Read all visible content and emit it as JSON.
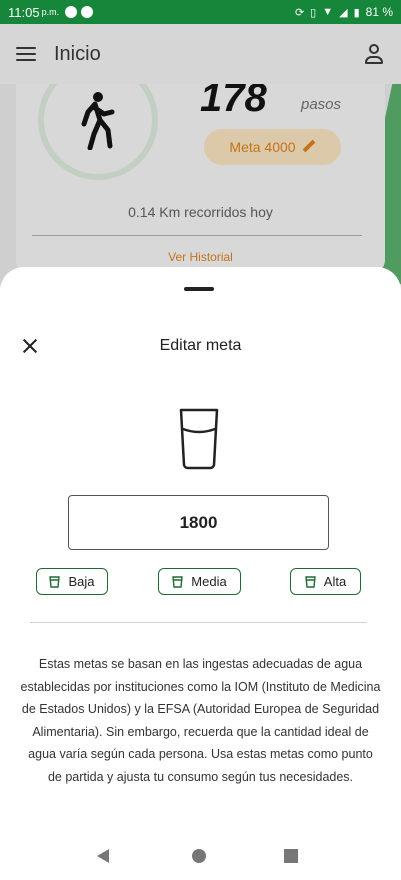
{
  "status_bar": {
    "time": "11:05",
    "ampm": "p.m.",
    "battery": "81 %"
  },
  "app_bar": {
    "title": "Inicio"
  },
  "background_card": {
    "steps": "178",
    "steps_unit": "pasos",
    "goal_label": "Meta 4000",
    "distance_text": "0.14 Km recorridos hoy",
    "history_link": "Ver Historial"
  },
  "sheet": {
    "title": "Editar meta",
    "amount_value": "1800",
    "levels": [
      {
        "label": "Baja"
      },
      {
        "label": "Media"
      },
      {
        "label": "Alta"
      }
    ],
    "info_text": "Estas metas se basan en las ingestas adecuadas de agua establecidas por instituciones como la IOM (Instituto de Medicina de Estados Unidos) y la EFSA (Autoridad Europea de Seguridad Alimentaria). Sin embargo, recuerda que la cantidad ideal de agua varía según cada persona. Usa estas metas como punto de partida y ajusta tu consumo según tus necesidades."
  },
  "colors": {
    "status_bar": "#16863a",
    "accent_orange": "#c4731a",
    "button_border": "#1d6b30"
  }
}
